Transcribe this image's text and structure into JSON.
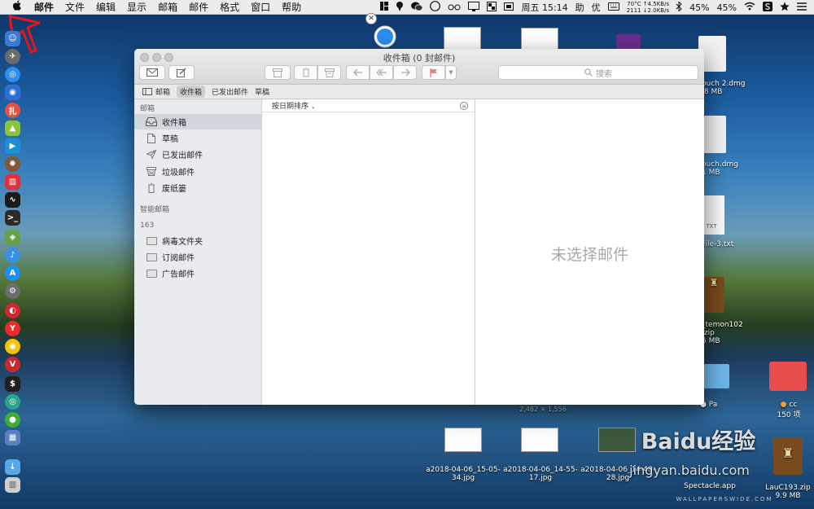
{
  "menubar": {
    "apple": "",
    "app": "邮件",
    "items": [
      "文件",
      "编辑",
      "显示",
      "邮箱",
      "邮件",
      "格式",
      "窗口",
      "帮助"
    ]
  },
  "status": {
    "temp_line1": "70°C ↑4.5KB/s",
    "temp_line2": "2111 ↓2.0KB/s",
    "datetime": "周五 15:14",
    "input1": "助",
    "input2": "优",
    "battery1": "45%",
    "battery2": "45%"
  },
  "desktop": {
    "files": [
      {
        "name": "ouch 2.dmg",
        "size": ".8 MB"
      },
      {
        "name": "ouch.dmg",
        "size": "1 MB"
      },
      {
        "name": "File-3.txt",
        "size": ""
      },
      {
        "name": "_temon102 .zip",
        "size": "5 MB"
      },
      {
        "name": "Pa",
        "size": ""
      },
      {
        "name": "cc",
        "size": "150 项"
      },
      {
        "name": "LauC193.zip",
        "size": "9.9 MB"
      },
      {
        "name": "Spectacle.app",
        "size": ""
      }
    ],
    "shots": [
      {
        "name": "a2018-04-06_15-05-34.jpg"
      },
      {
        "name": "a2018-04-06_14-55-17.jpg"
      },
      {
        "name": "a2018-04-06_14-48-28.jpg"
      }
    ],
    "dimension_label": "2,482 × 1,556",
    "txt_tag": "TXT",
    "watermark": "Baidu经验",
    "watermark_url": "jingyan.baidu.com",
    "wallpaper_credit": "WALLPAPERSWIDE.COM"
  },
  "window": {
    "title": "收件箱 (0 封邮件)",
    "search_placeholder": "搜索",
    "favorites": [
      "邮箱",
      "收件箱",
      "已发出邮件",
      "草稿"
    ],
    "sidebar": {
      "header_mailboxes": "邮箱",
      "mailboxes": [
        "收件箱",
        "草稿",
        "已发出邮件",
        "垃圾邮件",
        "废纸篓"
      ],
      "header_smart": "智能邮箱",
      "header_account": "163",
      "folders": [
        "病毒文件夹",
        "订阅邮件",
        "广告邮件"
      ]
    },
    "sort_label": "按日期排序",
    "no_selection": "未选择邮件"
  },
  "colors": {
    "sidebar_selected": "#d2d7de",
    "flag": "#e24b3b",
    "folder_blue": "#6db6e8",
    "folder_red": "#e74c4c"
  }
}
